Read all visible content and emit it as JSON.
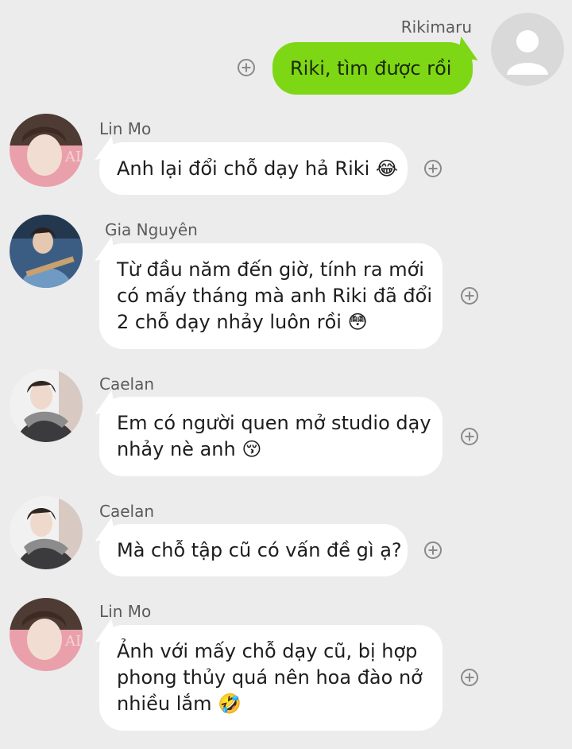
{
  "theme": {
    "background": "#ececec",
    "my_bubble_color": "#7ed714",
    "their_bubble_color": "#ffffff",
    "name_color": "#5b5b5b"
  },
  "messages": [
    {
      "sender": "Rikimaru",
      "lines": [
        "Riki, tìm được rồi"
      ],
      "avatar": "default-avatar-icon",
      "mine": true
    },
    {
      "sender": "Lin Mo",
      "lines": [
        "Anh lại đổi chỗ dạy hả Riki 😂"
      ],
      "avatar": "photo-avatar"
    },
    {
      "sender": "Gia Nguyên",
      "lines": [
        "Từ đầu năm đến giờ, tính ra mới",
        "có mấy tháng mà anh Riki đã đổi",
        "2 chỗ dạy nhảy luôn rồi 😳"
      ],
      "avatar": "photo-avatar"
    },
    {
      "sender": "Caelan",
      "lines": [
        "Em có người quen mở studio dạy",
        "nhảy nè anh 😚"
      ],
      "avatar": "photo-avatar"
    },
    {
      "sender": "Caelan",
      "lines": [
        "Mà chỗ tập cũ có vấn đề gì ạ?"
      ],
      "avatar": "photo-avatar"
    },
    {
      "sender": "Lin Mo",
      "lines": [
        "Ảnh với mấy chỗ dạy cũ, bị hợp",
        "phong thủy quá nên hoa đào nở",
        "nhiều lắm 🤣"
      ],
      "avatar": "photo-avatar"
    }
  ]
}
